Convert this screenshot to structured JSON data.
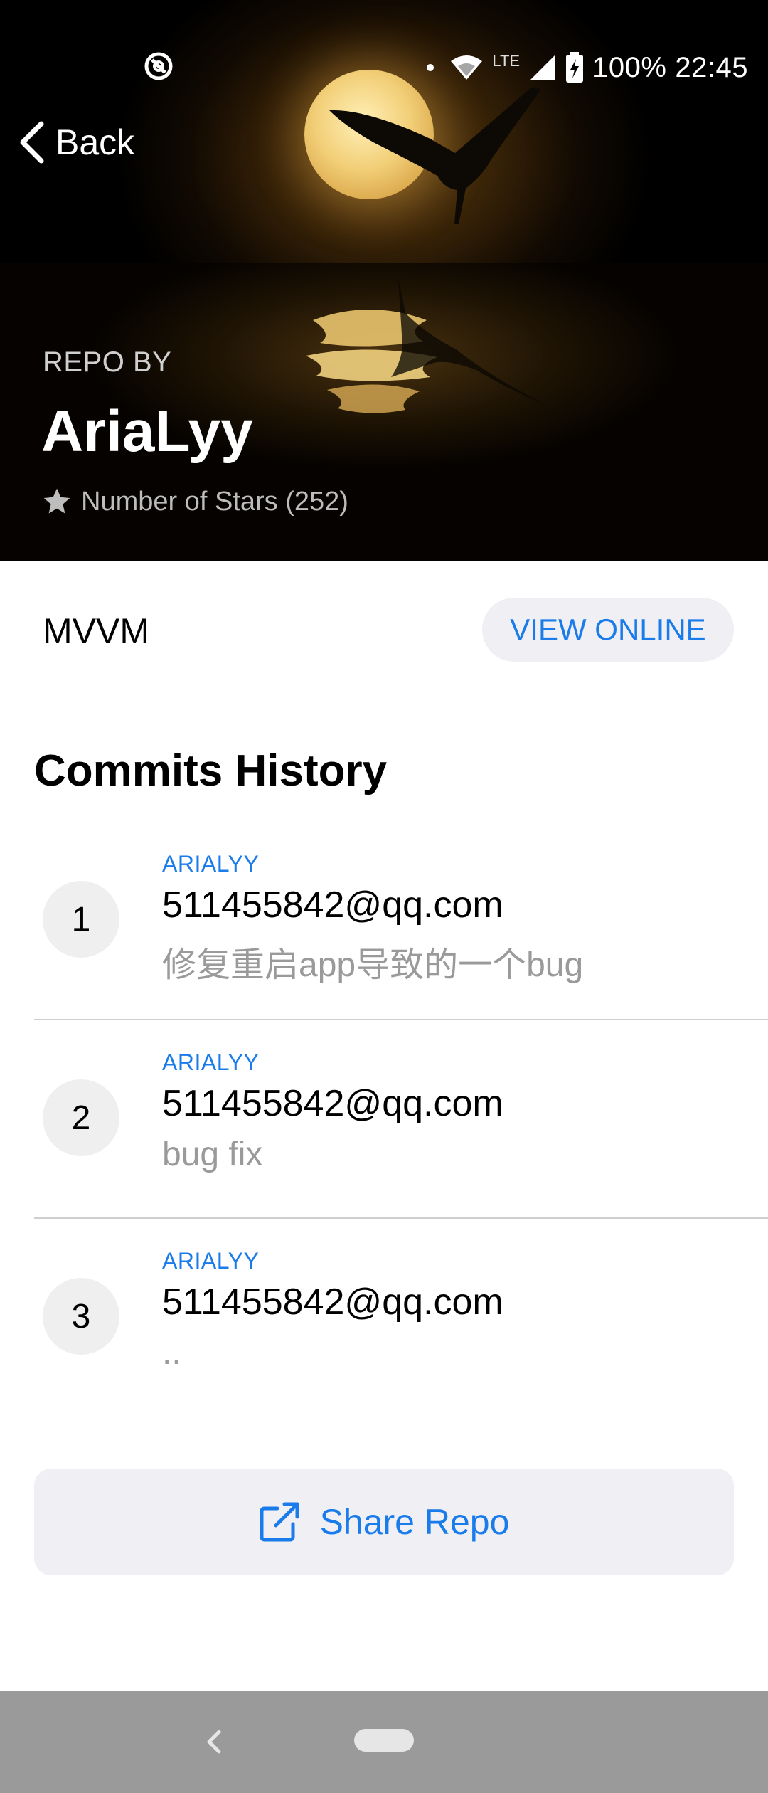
{
  "status_bar": {
    "battery": "100%",
    "time": "22:45",
    "network": "LTE",
    "icons": [
      "sync-icon",
      "wifi-icon",
      "signal-icon",
      "battery-charging-icon"
    ]
  },
  "header": {
    "back_label": "Back",
    "repo_by_label": "REPO BY",
    "author": "AriaLyy",
    "stars_label": "Number of Stars (252)"
  },
  "repo": {
    "name": "MVVM",
    "view_online_label": "VIEW ONLINE"
  },
  "commits": {
    "title": "Commits History",
    "items": [
      {
        "number": "1",
        "author": "ARIALYY",
        "email": "511455842@qq.com",
        "message": "修复重启app导致的一个bug"
      },
      {
        "number": "2",
        "author": "ARIALYY",
        "email": "511455842@qq.com",
        "message": "bug fix"
      },
      {
        "number": "3",
        "author": "ARIALYY",
        "email": "511455842@qq.com",
        "message": ".."
      }
    ]
  },
  "share": {
    "label": "Share Repo"
  },
  "colors": {
    "accent": "#1a7bea",
    "muted": "#9a9a9a",
    "chip_bg": "#efeff4"
  }
}
